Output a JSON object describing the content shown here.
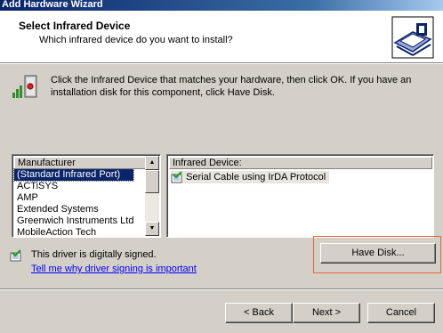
{
  "window": {
    "title": "Add Hardware Wizard"
  },
  "header": {
    "title": "Select Infrared Device",
    "subtitle": "Which infrared device do you want to install?"
  },
  "instructions": "Click the Infrared Device that matches your hardware, then click OK. If you have an installation disk for this component, click Have Disk.",
  "manufacturer_list": {
    "header": "Manufacturer",
    "items": [
      "(Standard Infrared Port)",
      "ACTiSYS",
      "AMP",
      "Extended Systems",
      "Greenwich Instruments Ltd",
      "MobileAction Tech"
    ],
    "selected": "(Standard Infrared Port)"
  },
  "device_list": {
    "header": "Infrared Device:",
    "items": [
      "Serial Cable using IrDA Protocol"
    ]
  },
  "signing": {
    "status": "This driver is digitally signed.",
    "link": "Tell me why driver signing is important"
  },
  "buttons": {
    "have_disk": "Have Disk...",
    "back": "< Back",
    "next": "Next >",
    "cancel": "Cancel"
  },
  "colors": {
    "titlebar": "#0a246a",
    "selection": "#0a246a",
    "link": "#0000ff",
    "highlight_box": "#e8643c",
    "dialog_bg": "#d4d0c8"
  }
}
